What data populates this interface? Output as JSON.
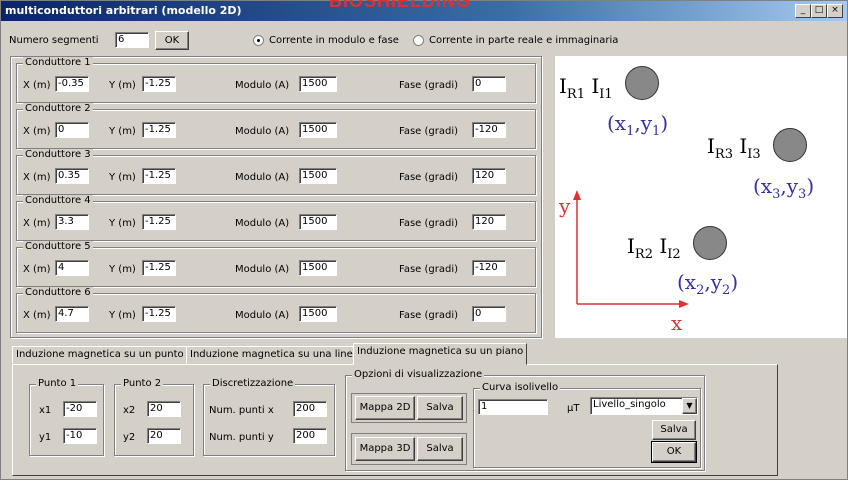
{
  "window": {
    "title": "multiconduttori arbitrari (modello 2D)",
    "banner": "BIOSHIELDING",
    "controls": [
      "_",
      "□",
      "×"
    ]
  },
  "top": {
    "segments_label": "Numero segmenti",
    "segments_value": "6",
    "ok_label": "OK",
    "radio1_label": "Corrente in modulo e fase",
    "radio2_label": "Corrente in parte reale e immaginaria"
  },
  "labels": {
    "x": "X (m)",
    "y": "Y (m)",
    "modulo": "Modulo (A)",
    "fase": "Fase (gradi)"
  },
  "conductors": [
    {
      "title": "Conduttore 1",
      "x": "-0.35",
      "y": "-1.25",
      "modulo": "1500",
      "fase": "0"
    },
    {
      "title": "Conduttore 2",
      "x": "0",
      "y": "-1.25",
      "modulo": "1500",
      "fase": "-120"
    },
    {
      "title": "Conduttore 3",
      "x": "0.35",
      "y": "-1.25",
      "modulo": "1500",
      "fase": "120"
    },
    {
      "title": "Conduttore 4",
      "x": "3.3",
      "y": "-1.25",
      "modulo": "1500",
      "fase": "120"
    },
    {
      "title": "Conduttore 5",
      "x": "4",
      "y": "-1.25",
      "modulo": "1500",
      "fase": "-120"
    },
    {
      "title": "Conduttore 6",
      "x": "4.7",
      "y": "-1.25",
      "modulo": "1500",
      "fase": "0"
    }
  ],
  "diagram": {
    "c1_label": "I",
    "c1_sub_r": "R1",
    "c1_i": "I",
    "c1_sub_i": "I1",
    "c1_coord": "(x",
    "c1_coord_sub1": "1",
    "c1_coord_mid": ",y",
    "c1_coord_sub2": "1",
    "c1_coord_end": ")",
    "c3_sub_r": "R3",
    "c3_sub_i": "I3",
    "c3_coord_sub": "3",
    "c2_sub_r": "R2",
    "c2_sub_i": "I2",
    "c2_coord_sub": "2",
    "axis_x": "x",
    "axis_y": "y"
  },
  "tabs": [
    {
      "label": "Induzione magnetica su un punto",
      "active": false
    },
    {
      "label": "Induzione magnetica su una linea",
      "active": false
    },
    {
      "label": "Induzione magnetica su un piano",
      "active": true
    }
  ],
  "plane": {
    "punto1": {
      "title": "Punto 1",
      "x_label": "x1",
      "x_value": "-20",
      "y_label": "y1",
      "y_value": "-10"
    },
    "punto2": {
      "title": "Punto 2",
      "x_label": "x2",
      "x_value": "20",
      "y_label": "y2",
      "y_value": "20"
    },
    "discr": {
      "title": "Discretizzazione",
      "nx_label": "Num. punti x",
      "nx_value": "200",
      "ny_label": "Num. punti y",
      "ny_value": "200"
    },
    "opzioni": {
      "title": "Opzioni di visualizzazione",
      "mappa2d": "Mappa 2D",
      "salva1": "Salva",
      "mappa3d": "Mappa 3D",
      "salva2": "Salva"
    },
    "isolivello": {
      "title": "Curva isolivello",
      "value": "1",
      "unit": "µT",
      "select_value": "Livello_singolo",
      "salva": "Salva",
      "ok": "OK"
    }
  }
}
